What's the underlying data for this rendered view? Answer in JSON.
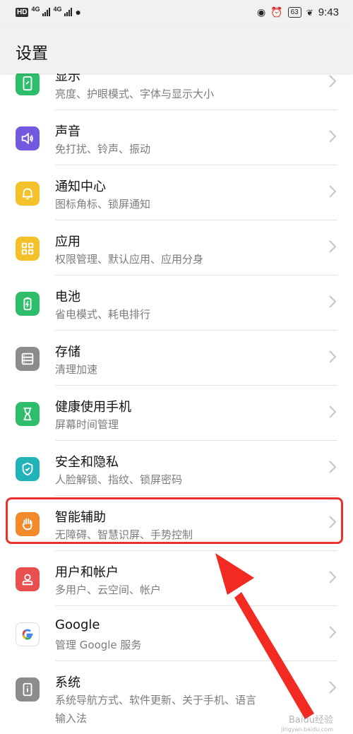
{
  "status_bar": {
    "hd": "HD",
    "net1": "4G",
    "net2": "4G",
    "battery": "63",
    "time": "9:43"
  },
  "header": {
    "title": "设置"
  },
  "items": [
    {
      "title": "显示",
      "subtitle": "亮度、护眼模式、字体与显示大小",
      "icon": "display-icon",
      "color": "#2ebd6b"
    },
    {
      "title": "声音",
      "subtitle": "免打扰、铃声、振动",
      "icon": "speaker-icon",
      "color": "#7358e0"
    },
    {
      "title": "通知中心",
      "subtitle": "图标角标、锁屏通知",
      "icon": "bell-icon",
      "color": "#f5c12a"
    },
    {
      "title": "应用",
      "subtitle": "权限管理、默认应用、应用分身",
      "icon": "apps-grid-icon",
      "color": "#f5c12a"
    },
    {
      "title": "电池",
      "subtitle": "省电模式、耗电排行",
      "icon": "battery-icon",
      "color": "#2ebd6b"
    },
    {
      "title": "存储",
      "subtitle": "清理加速",
      "icon": "storage-icon",
      "color": "#8c8c8c"
    },
    {
      "title": "健康使用手机",
      "subtitle": "屏幕时间管理",
      "icon": "hourglass-icon",
      "color": "#2ebd6b"
    },
    {
      "title": "安全和隐私",
      "subtitle": "人脸解锁、指纹、锁屏密码",
      "icon": "shield-icon",
      "color": "#22b3b8"
    },
    {
      "title": "智能辅助",
      "subtitle": "无障碍、智慧识屏、手势控制",
      "icon": "hand-icon",
      "color": "#f2892b"
    },
    {
      "title": "用户和帐户",
      "subtitle": "多用户、云空间、帐户",
      "icon": "user-icon",
      "color": "#ea4f4f"
    },
    {
      "title": "Google",
      "subtitle": "管理 Google 服务",
      "icon": "google-icon",
      "color": "#ffffff"
    },
    {
      "title": "系统",
      "subtitle": "系统导航方式、软件更新、关于手机、语言",
      "subtitle2": "输入法",
      "icon": "system-info-icon",
      "color": "#8c8c8c"
    }
  ],
  "watermark": {
    "text": "Baidu经验",
    "sub": "jingyan.baidu.com"
  }
}
